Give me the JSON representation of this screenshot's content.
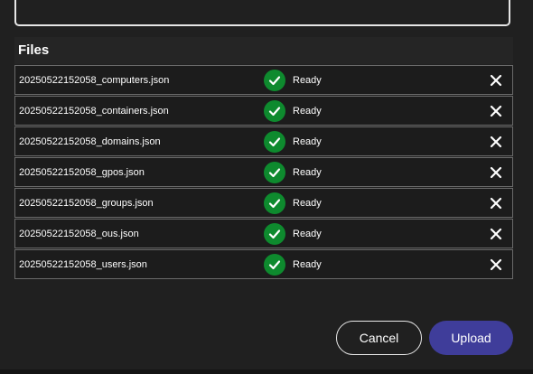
{
  "files_section": {
    "title": "Files"
  },
  "files": [
    {
      "name": "20250522152058_computers.json",
      "status": "Ready"
    },
    {
      "name": "20250522152058_containers.json",
      "status": "Ready"
    },
    {
      "name": "20250522152058_domains.json",
      "status": "Ready"
    },
    {
      "name": "20250522152058_gpos.json",
      "status": "Ready"
    },
    {
      "name": "20250522152058_groups.json",
      "status": "Ready"
    },
    {
      "name": "20250522152058_ous.json",
      "status": "Ready"
    },
    {
      "name": "20250522152058_users.json",
      "status": "Ready"
    }
  ],
  "icons": {
    "status": "check-circle-icon",
    "remove": "close-icon"
  },
  "colors": {
    "status_ok": "#0e8a2e",
    "primary": "#3f3d9a",
    "background": "#202020"
  },
  "actions": {
    "cancel_label": "Cancel",
    "upload_label": "Upload"
  }
}
